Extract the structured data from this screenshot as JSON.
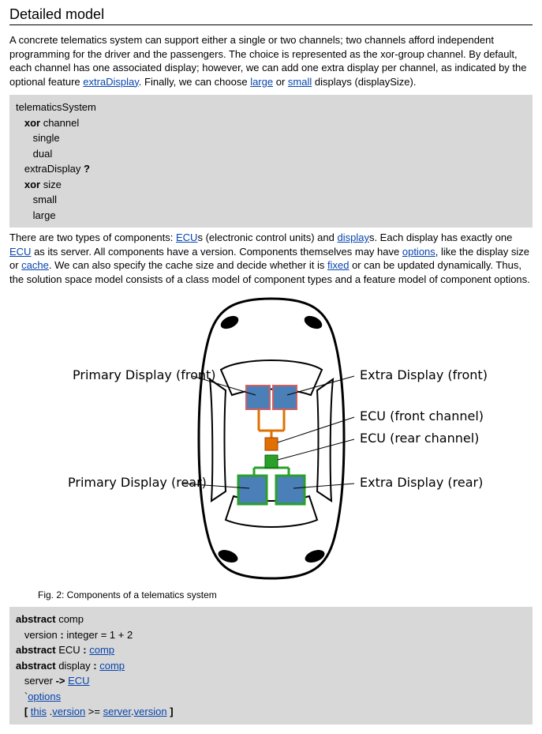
{
  "heading": "Detailed model",
  "para1_parts": [
    "A concrete telematics system can support either a single or two channels; two channels afford independent programming for the driver and the passengers. The choice is represented as the xor-group channel. By default, each channel has one associated display; however, we can add one extra display per channel, as indicated by the optional feature ",
    ". Finally, we can choose ",
    " or ",
    " displays (displaySize)."
  ],
  "para1_links": {
    "extraDisplay": "extraDisplay",
    "large": "large",
    "small": "small"
  },
  "code1": {
    "l0": "telematicsSystem",
    "l1_kw": "xor",
    "l1_rest": " channel",
    "l2": "single",
    "l3": "dual",
    "l4_a": "extraDisplay ",
    "l4_kw": "?",
    "l5_kw": "xor",
    "l5_rest": " size",
    "l6": "small",
    "l7": "large"
  },
  "para2_parts": [
    "There are two types of components: ",
    "s (electronic control units) and ",
    "s. Each display has exactly one ",
    " as its server. All components have a version. Components themselves may have ",
    ", like the display size or ",
    ". We can also specify the cache size and decide whether it is ",
    " or can be updated dynamically. Thus, the solution space model consists of a class model of component types and a feature model of component options."
  ],
  "para2_links": {
    "ECU1": "ECU",
    "display": "display",
    "ECU2": "ECU",
    "options": "options",
    "cache": "cache",
    "fixed": "fixed"
  },
  "diagram_labels": {
    "pdf": "Primary Display (front)",
    "edf": "Extra Display (front)",
    "ecuf": "ECU (front channel)",
    "ecur": "ECU (rear channel)",
    "pdr": "Primary Display (rear)",
    "edr": "Extra Display (rear)"
  },
  "fig_caption": "Fig. 2: Components of a telematics system",
  "code2": {
    "l0_kw": "abstract",
    "l0_rest": " comp",
    "l1_a": "version ",
    "l1_kw": ":",
    "l1_b": " integer = 1 + 2",
    "l2_kw": "abstract",
    "l2_a": " ECU ",
    "l2_kw2": ":",
    "l2_link": "comp",
    "l3_kw": "abstract",
    "l3_a": " display ",
    "l3_kw2": ":",
    "l3_link": "comp",
    "l4_a": "server ",
    "l4_kw": "->",
    "l4_link": "ECU",
    "l5_a": "`",
    "l5_link": "options",
    "l6_a": "[ ",
    "l6_link1": "this",
    "l6_b": " .",
    "l6_link2": "version",
    "l6_c": " >= ",
    "l6_link3": "server",
    "l6_d": ".",
    "l6_link4": "version",
    "l6_e": " ",
    "l6_kw": "]"
  }
}
